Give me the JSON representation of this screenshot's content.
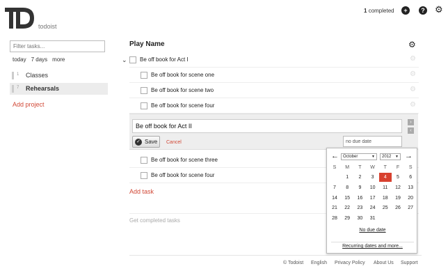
{
  "header": {
    "logo_text": "todoist",
    "completed_count": "1",
    "completed_label": "completed",
    "add_icon": "plus-icon",
    "help_icon": "question-icon",
    "settings_icon": "gear-icon"
  },
  "sidebar": {
    "filter_placeholder": "Filter tasks...",
    "quick": [
      "today",
      "7 days",
      "more"
    ],
    "projects": [
      {
        "num": "1",
        "name": "Classes"
      },
      {
        "num": "7",
        "name": "Rehearsals"
      }
    ],
    "add_project": "Add project"
  },
  "main": {
    "list_title": "Play Name",
    "tasks_before": [
      "Be off book for Act I",
      "Be off book for scene one",
      "Be off book for scene two",
      "Be off book for scene four"
    ],
    "editor": {
      "value": "Be off book for Act II",
      "save": "Save",
      "cancel": "Cancel",
      "due": "no due date"
    },
    "tasks_after": [
      "Be off book for scene three",
      "Be off book for scene four"
    ],
    "add_task": "Add task",
    "get_completed": "Get completed tasks"
  },
  "calendar": {
    "month": "October",
    "year": "2012",
    "weekdays": [
      "S",
      "M",
      "T",
      "W",
      "T",
      "F",
      "S"
    ],
    "weeks": [
      [
        "",
        "1",
        "2",
        "3",
        "4",
        "5",
        "6"
      ],
      [
        "7",
        "8",
        "9",
        "10",
        "11",
        "12",
        "13"
      ],
      [
        "14",
        "15",
        "16",
        "17",
        "18",
        "19",
        "20"
      ],
      [
        "21",
        "22",
        "23",
        "24",
        "25",
        "26",
        "27"
      ],
      [
        "28",
        "29",
        "30",
        "31",
        "",
        "",
        ""
      ]
    ],
    "selected_day": "4",
    "no_due": "No due date",
    "recurring": "Recurring dates and more..."
  },
  "footer": {
    "copyright": "© Todoist",
    "links": [
      "English",
      "Privacy Policy",
      "About Us",
      "Support"
    ]
  },
  "colors": {
    "accent_red": "#d14836",
    "selected_day": "#d8412f"
  }
}
